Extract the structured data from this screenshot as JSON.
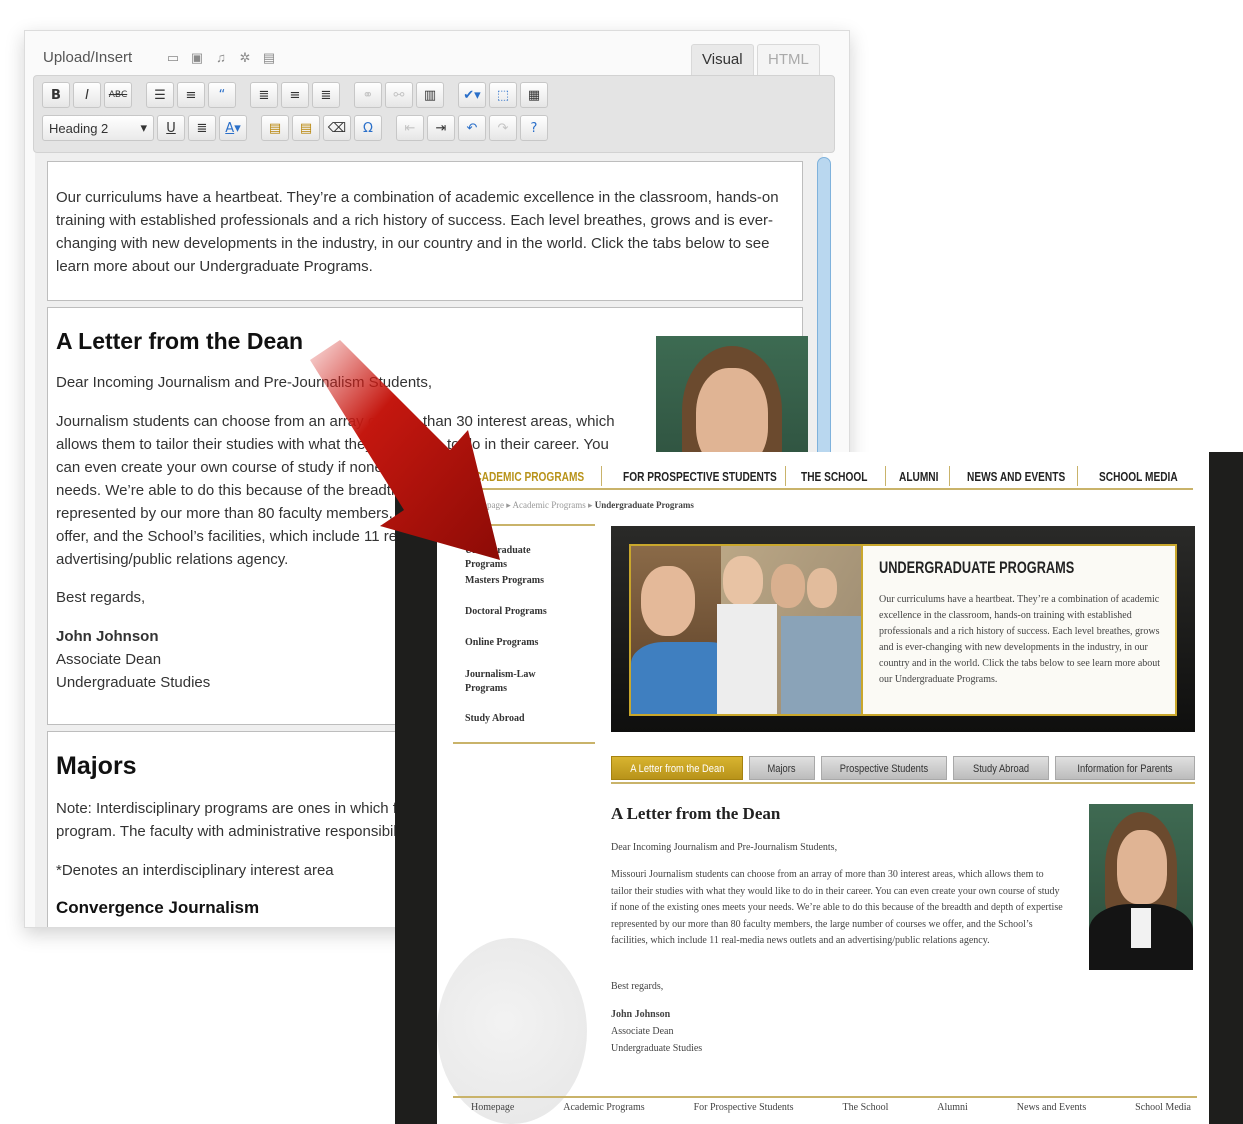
{
  "editor": {
    "upload_label": "Upload/Insert",
    "media_icons": [
      "image-icon",
      "video-icon",
      "music-icon",
      "media-icon",
      "document-icon"
    ],
    "tab_visual": "Visual",
    "tab_html": "HTML",
    "format_select": "Heading 2",
    "intro_paragraph": "Our curriculums have a heartbeat. They’re a combination of academic excellence in the classroom, hands-on training with established professionals and a rich history of success. Each level breathes, grows and is ever-changing with new developments in the industry, in our country and in the world. Click the tabs below to see learn more about our Undergraduate Programs.",
    "letter_heading": "A Letter from the Dean",
    "letter_greeting": "Dear Incoming Journalism and Pre-Journalism Students,",
    "letter_body": "Journalism students can choose from an array of more than 30 interest areas, which allows them to tailor their studies with what they would like to do in their career. You can even create your own course of study if none of the existing ones meets your needs. We’re able to do this because of the breadth and depth of expertise represented by our more than 80 faculty members, the large number of courses we offer, and the School’s facilities, which include 11 real-media news outlets and an advertising/public relations agency.",
    "letter_closing": "Best regards,",
    "signer_name": "John Johnson",
    "signer_title": "Associate Dean",
    "signer_dept": "Undergraduate Studies",
    "majors_heading": "Majors",
    "majors_note": "Note: Interdisciplinary programs are ones in which faculty from more than one sequence are teaching the program. The faculty with administrative responsibility for the program is listed first.",
    "majors_asterisk": "*Denotes an interdisciplinary interest area",
    "majors_sub": "Convergence Journalism"
  },
  "site": {
    "nav": [
      "ACADEMIC PROGRAMS",
      "FOR PROSPECTIVE STUDENTS",
      "THE SCHOOL",
      "ALUMNI",
      "NEWS AND EVENTS",
      "SCHOOL MEDIA"
    ],
    "breadcrumb": {
      "home": "Homepage",
      "section": "Academic Programs",
      "current": "Undergraduate Programs"
    },
    "sidebar": [
      "Undergraduate Programs",
      "Masters Programs",
      "Doctoral Programs",
      "Online Programs",
      "Journalism-Law Programs",
      "Study Abroad"
    ],
    "hero_title": "UNDERGRADUATE PROGRAMS",
    "hero_text": "Our curriculums have a heartbeat. They’re a combination of academic excellence in the classroom, hands-on training with established professionals and a rich history of success. Each level breathes, grows and is ever-changing with new developments in the industry, in our country and in the world. Click the tabs below to see learn more about our Undergraduate Programs.",
    "tabs": [
      "A Letter from the Dean",
      "Majors",
      "Prospective Students",
      "Study Abroad",
      "Information for Parents"
    ],
    "letter_heading": "A Letter from the Dean",
    "letter_greeting": "Dear Incoming Journalism and Pre-Journalism Students,",
    "letter_body": "Missouri Journalism students can choose from an array of more than 30 interest areas, which allows them to tailor their studies with what they would like to do in their career. You can even create your own course of study if none of the existing ones meets your needs. We’re able to do this because of the breadth and depth of expertise represented by our more than 80 faculty members, the large number of courses we offer, and the School’s facilities, which include 11 real-media news outlets and an advertising/public relations agency.",
    "letter_closing": "Best regards,",
    "signer_name": "John Johnson",
    "signer_title": "Associate Dean",
    "signer_dept": "Undergraduate Studies",
    "footer": [
      "Homepage",
      "Academic Programs",
      "For Prospective Students",
      "The School",
      "Alumni",
      "News and Events",
      "School Media"
    ]
  },
  "colors": {
    "accent_gold": "#c9a72c",
    "arrow_red": "#b3140f",
    "site_dark": "#1e1e1c"
  }
}
